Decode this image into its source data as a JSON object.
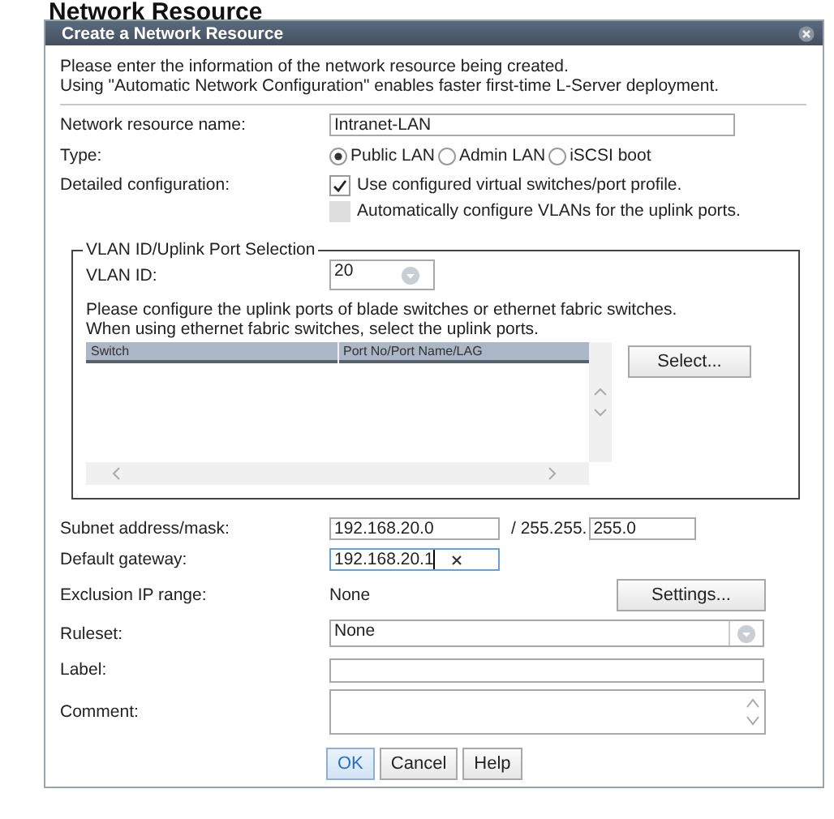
{
  "page_heading": "Network Resource",
  "dialog": {
    "title": "Create a Network Resource"
  },
  "intro": [
    "Please enter the information of the network resource being created.",
    "Using \"Automatic Network Configuration\" enables faster first-time L-Server deployment."
  ],
  "name": {
    "label": "Network resource name:",
    "value": "Intranet-LAN"
  },
  "type": {
    "label": "Type:",
    "options": [
      {
        "label": "Public LAN",
        "selected": true
      },
      {
        "label": "Admin LAN",
        "selected": false
      },
      {
        "label": "iSCSI boot",
        "selected": false
      }
    ]
  },
  "detailed": {
    "label": "Detailed configuration:",
    "options": [
      {
        "label": "Use configured virtual switches/port profile.",
        "checked": true,
        "disabled": false
      },
      {
        "label": "Automatically configure VLANs for the uplink ports.",
        "checked": false,
        "disabled": true
      }
    ]
  },
  "vlan_group": {
    "legend": "VLAN ID/Uplink Port Selection",
    "vlan_label": "VLAN ID:",
    "vlan_value": "20",
    "note": [
      "Please configure the uplink ports of blade switches or ethernet fabric switches.",
      "When using ethernet fabric switches, select the uplink ports."
    ],
    "table": {
      "columns": [
        "Switch",
        "Port No/Port Name/LAG"
      ]
    },
    "select_button": "Select..."
  },
  "subnet": {
    "label": "Subnet address/mask:",
    "address": "192.168.20.0",
    "separator": "/ 255.255.",
    "mask": "255.0"
  },
  "gateway": {
    "label": "Default gateway:",
    "value": "192.168.20.1",
    "focused": true
  },
  "exclusion": {
    "label": "Exclusion IP range:",
    "value": "None",
    "button": "Settings..."
  },
  "ruleset": {
    "label": "Ruleset:",
    "value": "None"
  },
  "label_field": {
    "label": "Label:"
  },
  "comment": {
    "label": "Comment:"
  },
  "buttons": [
    {
      "label": "OK",
      "default": true
    },
    {
      "label": "Cancel",
      "default": false
    },
    {
      "label": "Help",
      "default": false
    }
  ]
}
